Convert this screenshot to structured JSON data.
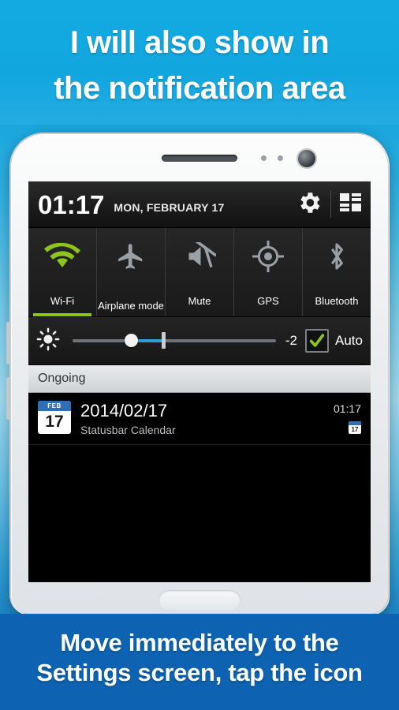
{
  "banner_top": {
    "line1": "I will also show in",
    "line2": "the notification area"
  },
  "banner_bottom": {
    "line1": "Move immediately to the",
    "line2": "Settings screen, tap the icon"
  },
  "phone": {
    "statusbar": {
      "clock": "01:17",
      "date": "MON, FEBRUARY 17",
      "settings_icon": "gear-icon",
      "grid_icon": "quick-settings-grid-icon"
    },
    "toggles": [
      {
        "label": "Wi-Fi",
        "icon": "wifi-icon",
        "state": "on"
      },
      {
        "label": "Airplane mode",
        "icon": "airplane-icon",
        "state": "off"
      },
      {
        "label": "Mute",
        "icon": "mute-speaker-icon",
        "state": "off"
      },
      {
        "label": "GPS",
        "icon": "gps-target-icon",
        "state": "off"
      },
      {
        "label": "Bluetooth",
        "icon": "bluetooth-icon",
        "state": "off"
      }
    ],
    "brightness": {
      "icon": "brightness-sun-icon",
      "value": "-2",
      "auto_label": "Auto",
      "auto_checked": true
    },
    "ongoing_header": "Ongoing",
    "notification": {
      "icon_month": "FEB",
      "icon_day": "17",
      "title": "2014/02/17",
      "subtitle": "Statusbar Calendar",
      "time": "01:17",
      "mini_icon_day": "17"
    }
  },
  "colors": {
    "accent_green": "#8fc31f",
    "banner_blue": "#12a9e0",
    "bottom_banner_blue": "#0d63b1",
    "slider_blue": "#2f9fd8"
  }
}
